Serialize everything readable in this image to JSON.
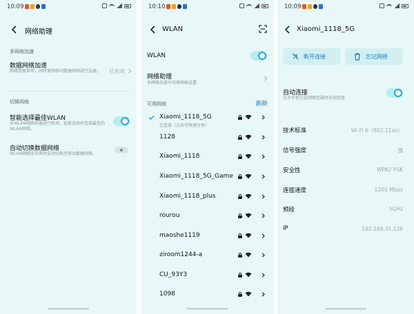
{
  "screens": {
    "assist": {
      "status_time": "10:09",
      "title": "网络助理",
      "section1_label": "多网络加速",
      "data_accel": {
        "title": "数据网络加速",
        "sub": "网络质量差时，同时使用移动数据网络进行加速。",
        "value": "已关闭"
      },
      "section2_label": "切换网络",
      "smart_wlan": {
        "title": "智能选择最佳WLAN",
        "sub": "对WLAN网络质量进行检测，智能选择并连接最佳的WLAN网络。"
      },
      "auto_switch": {
        "title": "自动切换数据网络",
        "sub": "WLAN网络信号差时自动切换至移动数据网络。"
      }
    },
    "wlan": {
      "status_time": "10:10",
      "title": "WLAN",
      "wlan_label": "WLAN",
      "assist": {
        "title": "网络助理",
        "sub": "多网络加速与切换网络设置"
      },
      "available_label": "可用网络",
      "refresh_label": "刷新",
      "networks": [
        {
          "name": "Xiaomi_1118_5G",
          "sub": "已连接（点击可快速分享）"
        },
        {
          "name": "1128",
          "sub": ""
        },
        {
          "name": "Xiaomi_1118",
          "sub": ""
        },
        {
          "name": "Xiaomi_1118_5G_Game",
          "sub": ""
        },
        {
          "name": "Xiaomi_1118_plus",
          "sub": ""
        },
        {
          "name": "rourou",
          "sub": ""
        },
        {
          "name": "maoshe1119",
          "sub": ""
        },
        {
          "name": "ziroom1244-a",
          "sub": ""
        },
        {
          "name": "CU_93Y3",
          "sub": ""
        },
        {
          "name": "1098",
          "sub": ""
        }
      ]
    },
    "detail": {
      "status_time": "10:09",
      "title": "Xiaomi_1118_5G",
      "disconnect_label": "断开连接",
      "forget_label": "忘记网络",
      "auto_connect": {
        "title": "自动连接",
        "sub": "允许手机在此网络范围时自动连接"
      },
      "rows": [
        {
          "key": "技术标准",
          "value": "Wi-Fi 6（802.11ax）"
        },
        {
          "key": "信号强度",
          "value": "强"
        },
        {
          "key": "安全性",
          "value": "WPA2 PSK"
        },
        {
          "key": "连接速度",
          "value": "1200 Mbps"
        },
        {
          "key": "频段",
          "value": "5GHz"
        },
        {
          "key": "IP",
          "value": "192.168.31.126"
        }
      ]
    }
  },
  "colors": {
    "background": "#e8f8f8",
    "accent": "#1aa8d8",
    "link": "#1a7fbf",
    "button_bg": "#d3eff2"
  }
}
